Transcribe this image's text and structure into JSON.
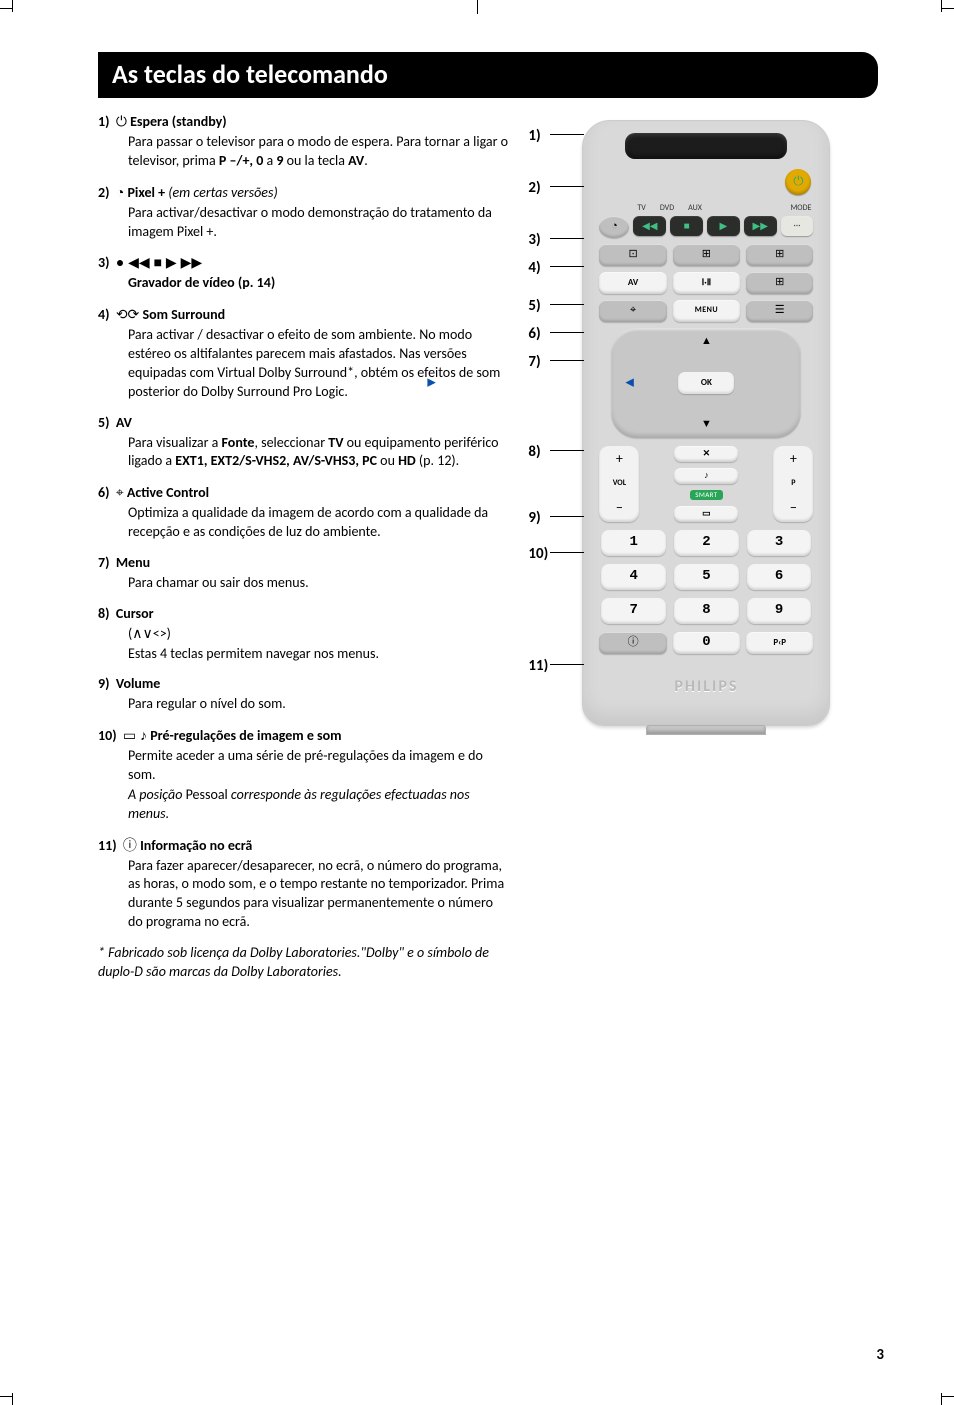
{
  "title": "As teclas do telecomando",
  "page_number": "3",
  "footnote": "* Fabricado sob licença da Dolby Laboratories.\"Dolby\" e o símbolo de duplo-D são marcas da Dolby Laboratories.",
  "items": [
    {
      "num": "1)",
      "icon": "⏻",
      "heading": "Espera (standby)",
      "body_html": "Para passar o televisor para o modo de espera. Para tornar a ligar o televisor, prima <b>P –/+, 0</b> a <b>9</b> ou la tecla <b>AV</b>."
    },
    {
      "num": "2)",
      "icon": "◔",
      "heading": "Pixel +",
      "heading_suffix_italic": "(em certas versões)",
      "body_html": "Para activar/desactivar o modo demonstração do tratamento da imagem Pixel +."
    },
    {
      "num": "3)",
      "icon": "● ◀◀ ■ ▶ ▶▶",
      "heading": "",
      "extra_heading": "Gravador de vídeo (p. 14)",
      "body_html": ""
    },
    {
      "num": "4)",
      "icon": "⟲⟳",
      "heading": "Som Surround",
      "body_html": "Para activar / desactivar o efeito de som ambiente. No modo estéreo os altifalantes parecem mais afastados. Nas versões equipadas com Virtual Dolby Surround*, obtém os efeitos de som posterior do Dolby Surround Pro Logic."
    },
    {
      "num": "5)",
      "icon": "",
      "heading": "AV",
      "body_html": "Para visualizar a <b>Fonte</b>, seleccionar <b>TV</b> ou equipamento periférico ligado a <b>EXT1, EXT2/S-VHS2, AV/S-VHS3, PC</b> ou <b>HD</b> (p. 12)."
    },
    {
      "num": "6)",
      "icon": "⌖",
      "heading": "Active Control",
      "body_html": "Optimiza a qualidade da imagem de acordo com a qualidade da recepção e as condições de luz do ambiente."
    },
    {
      "num": "7)",
      "icon": "",
      "heading": "Menu",
      "body_html": "Para chamar ou sair dos menus."
    },
    {
      "num": "8)",
      "icon": "",
      "heading": "Cursor",
      "subline": "(∧∨<>)",
      "body_html": "Estas 4 teclas permitem navegar nos menus."
    },
    {
      "num": "9)",
      "icon": "",
      "heading": "Volume",
      "body_html": "Para regular o nível do som."
    },
    {
      "num": "10)",
      "icon": "▭ ♪",
      "heading": "Pré-regulações de imagem e som",
      "body_html": "Permite aceder a uma série de pré-regulações da imagem e do som.",
      "body_italic": "A posição <span style='font-style:normal'>Pessoal</span> corresponde às regulações efectuadas nos menus."
    },
    {
      "num": "11)",
      "icon": "ⓘ",
      "heading": "Informação no ecrã",
      "body_html": "Para fazer aparecer/desaparecer, no ecrã, o número do programa, as horas, o modo som, e o tempo restante no temporizador. Prima durante 5 segundos para visualizar permanentemente o número do programa no ecrã."
    }
  ],
  "callouts": [
    "1)",
    "2)",
    "3)",
    "4)",
    "5)",
    "6)",
    "7)",
    "8)",
    "9)",
    "10)",
    "11)"
  ],
  "remote": {
    "mode_labels": [
      "TV",
      "DVD",
      "AUX"
    ],
    "mode_btn": "MODE",
    "row1": [
      "⊡",
      "⊞",
      "⊞"
    ],
    "row2": [
      "AV",
      "Ⅰ·Ⅱ",
      "⊞"
    ],
    "row3": [
      "⌖",
      "MENU",
      "☰"
    ],
    "ok": "OK",
    "vol_label": "VOL",
    "p_label": "P",
    "mute": "✕",
    "note": "♪",
    "smart": "SMART",
    "pic": "▭",
    "digits": [
      "1",
      "2",
      "3",
      "4",
      "5",
      "6",
      "7",
      "8",
      "9"
    ],
    "bottom": [
      "ⓘ",
      "0",
      "P‹P"
    ],
    "brand": "PHILIPS",
    "transport": [
      "●",
      "◀◀",
      "■",
      "▶",
      "▶▶"
    ]
  }
}
